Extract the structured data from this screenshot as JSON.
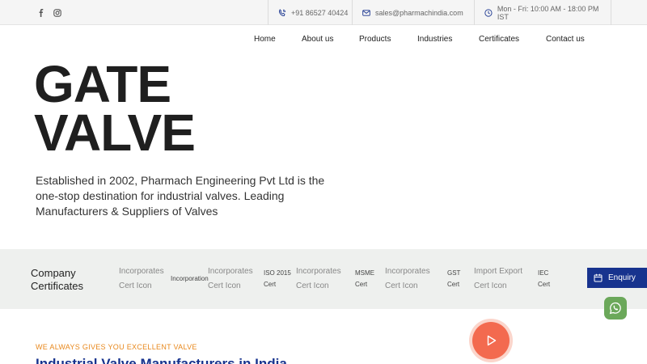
{
  "topbar": {
    "phone": "+91 86527 40424",
    "email": "sales@pharmachindia.com",
    "hours": "Mon - Fri: 10:00 AM - 18:00 PM IST"
  },
  "nav": {
    "items": [
      "Home",
      "About us",
      "Products",
      "Industries",
      "Certificates",
      "Contact us"
    ]
  },
  "hero": {
    "title_line1": "GATE",
    "title_line2": "VALVE",
    "description": "Established in 2002, Pharmach Engineering Pvt Ltd is the one-stop destination for industrial valves. Leading Manufacturers & Suppliers of Valves"
  },
  "certificates": {
    "heading_line1": "Company",
    "heading_line2": "Certificates",
    "items": [
      {
        "icon_line1": "Incorporates",
        "icon_line2": "Cert Icon",
        "label": "Incorporation"
      },
      {
        "icon_line1": "Incorporates",
        "icon_line2": "Cert Icon",
        "label_line1": "ISO 2015",
        "label_line2": "Cert"
      },
      {
        "icon_line1": "Incorporates",
        "icon_line2": "Cert Icon",
        "label_line1": "MSME",
        "label_line2": "Cert"
      },
      {
        "icon_line1": "Incorporates",
        "icon_line2": "Cert Icon",
        "label_line1": "GST",
        "label_line2": "Cert"
      },
      {
        "icon_line1": "Import Export",
        "icon_line2": "Cert Icon",
        "label_line1": "IEC",
        "label_line2": "Cert"
      }
    ]
  },
  "enquiry": {
    "label": "Enquiry"
  },
  "section": {
    "tagline": "WE ALWAYS GIVES YOU EXCELLENT VALVE",
    "title": "Industrial Valve Manufacturers in India"
  },
  "colors": {
    "brand_blue": "#17338e",
    "accent_orange": "#e8881c",
    "play_red": "#f36a4f",
    "whatsapp_green": "#6ba85a"
  }
}
